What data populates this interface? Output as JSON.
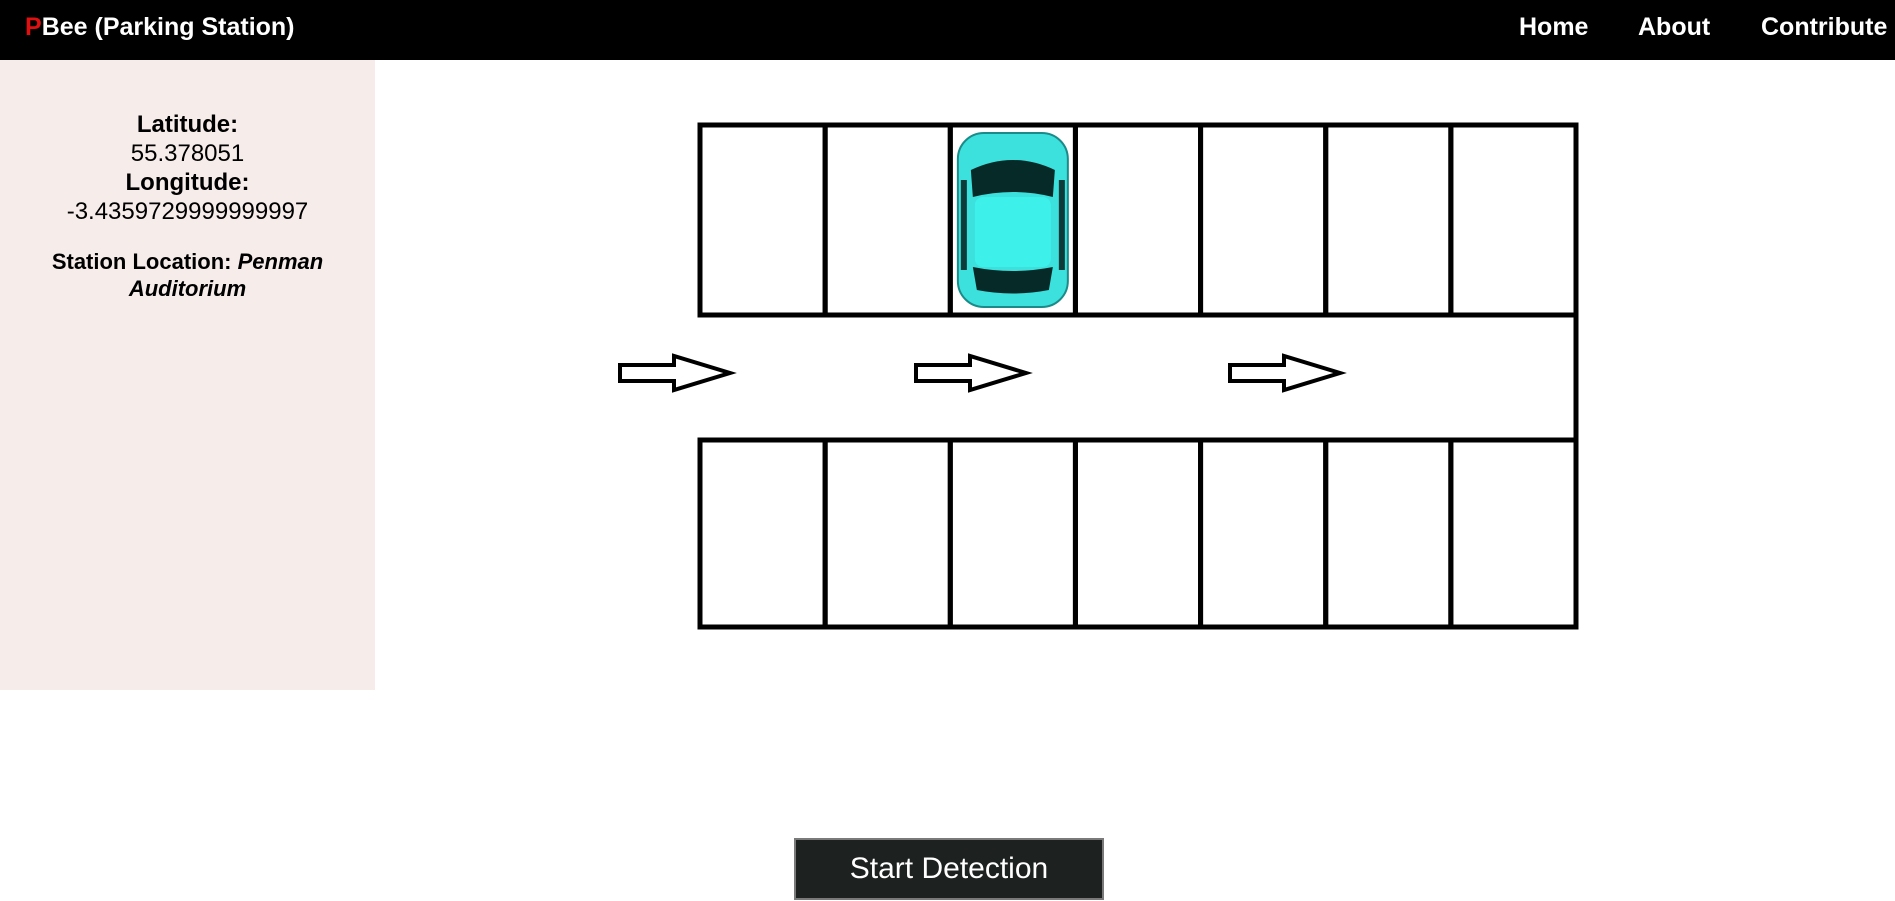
{
  "header": {
    "brand_initial": "P",
    "brand_rest": "Bee (Parking Station)",
    "nav": {
      "home": "Home",
      "about": "About",
      "contribute": "Contribute"
    }
  },
  "sidebar": {
    "latitude_label": "Latitude:",
    "latitude_value": "55.378051",
    "longitude_label": "Longitude:",
    "longitude_value": "-3.4359729999999997",
    "station_label": "Station Location:",
    "station_name": "Penman Auditorium"
  },
  "parking_lot": {
    "spots_per_row": 7,
    "rows": [
      {
        "row": "top",
        "occupied": [
          false,
          false,
          true,
          false,
          false,
          false,
          false
        ]
      },
      {
        "row": "bottom",
        "occupied": [
          false,
          false,
          false,
          false,
          false,
          false,
          false
        ]
      }
    ],
    "lane_arrows": 3,
    "car_color": "#3ce0dc"
  },
  "actions": {
    "start_detection": "Start Detection"
  },
  "colors": {
    "topbar": "#000000",
    "sidebar": "#f6ecea",
    "brand_accent": "#e01010",
    "button": "#1d211f"
  }
}
